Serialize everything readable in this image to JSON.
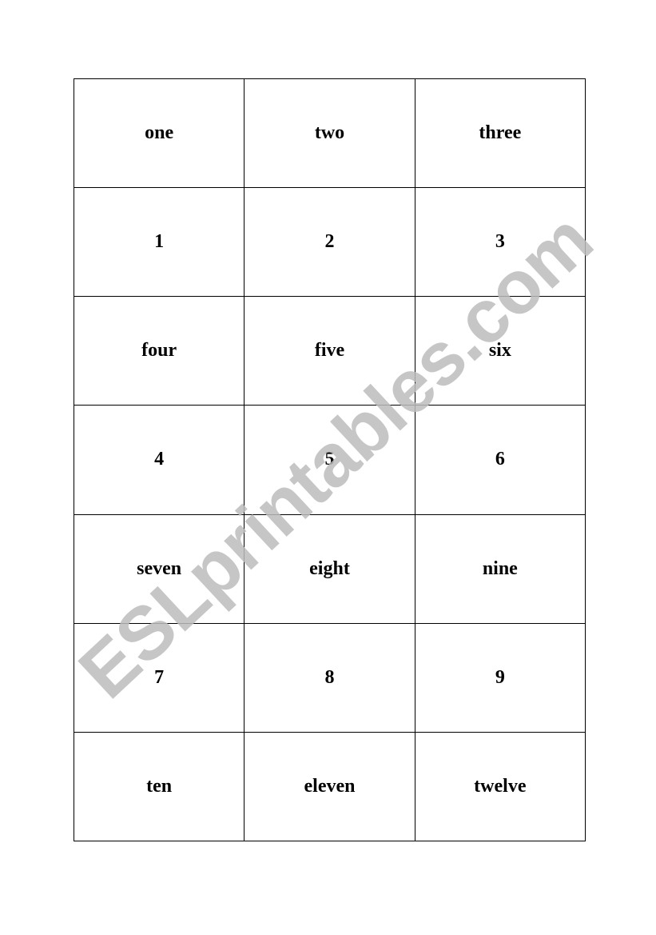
{
  "cards": [
    [
      "one",
      "two",
      "three"
    ],
    [
      "1",
      "2",
      "3"
    ],
    [
      "four",
      "five",
      "six"
    ],
    [
      "4",
      "5",
      "6"
    ],
    [
      "seven",
      "eight",
      "nine"
    ],
    [
      "7",
      "8",
      "9"
    ],
    [
      "ten",
      "eleven",
      "twelve"
    ]
  ],
  "watermark": "ESLprintables.com",
  "colors": {
    "border": "#000000",
    "text": "#000000",
    "watermark": "#bdbdbd"
  }
}
